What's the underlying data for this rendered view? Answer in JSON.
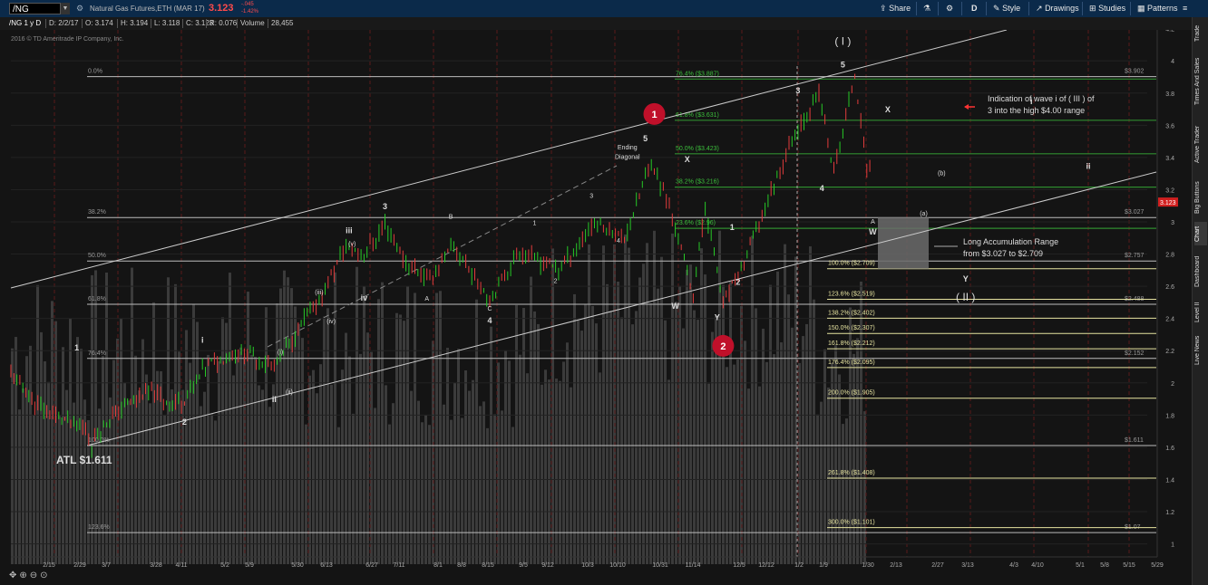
{
  "toolbar": {
    "symbol": "/NG",
    "description": "Natural Gas Futures,ETH (MAR 17)",
    "last": "3.123",
    "change": "-.045",
    "change_pct": "-1.42%",
    "share": "Share",
    "period": "D",
    "style": "Style",
    "drawings": "Drawings",
    "studies": "Studies",
    "patterns": "Patterns"
  },
  "infobar": {
    "name": "/NG 1 y D",
    "date": "D: 2/2/17",
    "open": "O: 3.174",
    "high": "H: 3.194",
    "low": "L: 3.118",
    "close": "C: 3.123",
    "range": "R: 0.076",
    "volume_label": "Volume",
    "volume": "28,455"
  },
  "sidebar": {
    "tabs": [
      "Trade",
      "Times And Sales",
      "Active Trader",
      "Big Buttons",
      "Chart",
      "Dashboard",
      "Level II",
      "Live News"
    ]
  },
  "chart": {
    "copyright": "2016 © TD Ameritrade IP Company, Inc.",
    "price_labels": [
      {
        "v": 4.2,
        "t": "4.2"
      },
      {
        "v": 4.0,
        "t": "4"
      },
      {
        "v": 3.8,
        "t": "3.8"
      },
      {
        "v": 3.6,
        "t": "3.6"
      },
      {
        "v": 3.4,
        "t": "3.4"
      },
      {
        "v": 3.2,
        "t": "3.2"
      },
      {
        "v": 3.0,
        "t": "3"
      },
      {
        "v": 2.8,
        "t": "2.8"
      },
      {
        "v": 2.6,
        "t": "2.6"
      },
      {
        "v": 2.4,
        "t": "2.4"
      },
      {
        "v": 2.2,
        "t": "2.2"
      },
      {
        "v": 2.0,
        "t": "2"
      },
      {
        "v": 1.8,
        "t": "1.8"
      },
      {
        "v": 1.6,
        "t": "1.6"
      },
      {
        "v": 1.4,
        "t": "1.4"
      },
      {
        "v": 1.2,
        "t": "1.2"
      },
      {
        "v": 1.0,
        "t": "1"
      }
    ],
    "last_price_tag": "3.123",
    "date_labels": [
      "2/15",
      "2/29",
      "3/7",
      "3/28",
      "4/11",
      "5/2",
      "5/9",
      "5/30",
      "6/13",
      "6/27",
      "7/11",
      "8/1",
      "8/8",
      "8/15",
      "9/5",
      "9/12",
      "10/3",
      "10/10",
      "10/31",
      "11/14",
      "12/5",
      "12/12",
      "1/2",
      "1/9",
      "1/30",
      "2/13",
      "2/27",
      "3/13",
      "4/3",
      "4/10",
      "5/1",
      "5/8",
      "5/15",
      "5/29"
    ],
    "fib_left": [
      {
        "label": "0.0%",
        "value": 3.902,
        "tag": "$3.902"
      },
      {
        "label": "38.2%",
        "value": 3.027,
        "tag": "$3.027"
      },
      {
        "label": "50.0%",
        "value": 2.757,
        "tag": "$2.757"
      },
      {
        "label": "61.8%",
        "value": 2.488,
        "tag": "$2.488"
      },
      {
        "label": "76.4%",
        "value": 2.152,
        "tag": "$2.152"
      },
      {
        "label": "100.0%",
        "value": 1.611,
        "tag": "$1.611"
      },
      {
        "label": "123.6%",
        "value": 1.07,
        "tag": "$1.07"
      }
    ],
    "fib_green": [
      {
        "label": "76.4% ($3.887)",
        "value": 3.887
      },
      {
        "label": "61.8% ($3.631)",
        "value": 3.631
      },
      {
        "label": "50.0% ($3.423)",
        "value": 3.423
      },
      {
        "label": "38.2% ($3.216)",
        "value": 3.216
      },
      {
        "label": "23.6% ($2.96)",
        "value": 2.96
      }
    ],
    "fib_ext": [
      {
        "label": "100.0% ($2.709)",
        "value": 2.709
      },
      {
        "label": "123.6% ($2.519)",
        "value": 2.519
      },
      {
        "label": "138.2% ($2.402)",
        "value": 2.402
      },
      {
        "label": "150.0% ($2.307)",
        "value": 2.307
      },
      {
        "label": "161.8% ($2.212)",
        "value": 2.212
      },
      {
        "label": "176.4% ($2.095)",
        "value": 2.095
      },
      {
        "label": "200.0% ($1.905)",
        "value": 1.905
      },
      {
        "label": "261.8% ($1.408)",
        "value": 1.408
      },
      {
        "label": "300.0% ($1.101)",
        "value": 1.101
      }
    ],
    "atl": "ATL $1.611",
    "annotation_wave": "Indication of wave i of ( III ) of\n3 into the high $4.00 range",
    "annotation_range": "Long Accumulation Range\nfrom $3.027 to $2.709",
    "wave_labels": [
      {
        "t": "1",
        "d": 22,
        "p": 2.2,
        "w": "b"
      },
      {
        "t": "2",
        "d": 58,
        "p": 1.74,
        "w": "b"
      },
      {
        "t": "i",
        "d": 64,
        "p": 2.25,
        "w": "b"
      },
      {
        "t": "ii",
        "d": 88,
        "p": 1.88,
        "w": "b"
      },
      {
        "t": "(i)",
        "d": 90,
        "p": 2.18,
        "w": "s"
      },
      {
        "t": "(ii)",
        "d": 93,
        "p": 1.93,
        "w": "s"
      },
      {
        "t": "(iii)",
        "d": 103,
        "p": 2.55,
        "w": "s"
      },
      {
        "t": "(iv)",
        "d": 107,
        "p": 2.37,
        "w": "s"
      },
      {
        "t": "(v)",
        "d": 114,
        "p": 2.85,
        "w": "s"
      },
      {
        "t": "iii",
        "d": 113,
        "p": 2.93,
        "w": "b"
      },
      {
        "t": "iv",
        "d": 118,
        "p": 2.51,
        "w": "b"
      },
      {
        "t": "3",
        "d": 125,
        "p": 3.08,
        "w": "b"
      },
      {
        "t": "A",
        "d": 139,
        "p": 2.51,
        "w": "s"
      },
      {
        "t": "B",
        "d": 147,
        "p": 3.02,
        "w": "s"
      },
      {
        "t": "C",
        "d": 160,
        "p": 2.45,
        "w": "s"
      },
      {
        "t": "4",
        "d": 160,
        "p": 2.37,
        "w": "b"
      },
      {
        "t": "1",
        "d": 175,
        "p": 2.98,
        "w": "s"
      },
      {
        "t": "2",
        "d": 182,
        "p": 2.62,
        "w": "s"
      },
      {
        "t": "3",
        "d": 194,
        "p": 3.15,
        "w": "s"
      },
      {
        "t": "4",
        "d": 203,
        "p": 2.87,
        "w": "s"
      },
      {
        "t": "Ending",
        "d": 206,
        "p": 3.45,
        "w": "s"
      },
      {
        "t": "Diagonal",
        "d": 206,
        "p": 3.39,
        "w": "s"
      },
      {
        "t": "5",
        "d": 212,
        "p": 3.5,
        "w": "b"
      },
      {
        "t": "W",
        "d": 222,
        "p": 2.46,
        "w": "b"
      },
      {
        "t": "X",
        "d": 226,
        "p": 3.37,
        "w": "b"
      },
      {
        "t": "Y",
        "d": 236,
        "p": 2.39,
        "w": "b"
      },
      {
        "t": "1",
        "d": 241,
        "p": 2.95,
        "w": "b"
      },
      {
        "t": "2",
        "d": 243,
        "p": 2.61,
        "w": "b"
      },
      {
        "t": "3",
        "d": 263,
        "p": 3.8,
        "w": "b"
      },
      {
        "t": "4",
        "d": 271,
        "p": 3.19,
        "w": "b"
      },
      {
        "t": "5",
        "d": 278,
        "p": 3.96,
        "w": "b"
      },
      {
        "t": "( I )",
        "d": 278,
        "p": 4.1,
        "w": "l"
      },
      {
        "t": "A",
        "d": 288,
        "p": 2.99,
        "w": "s"
      },
      {
        "t": "W",
        "d": 288,
        "p": 2.92,
        "w": "b"
      },
      {
        "t": "X",
        "d": 293,
        "p": 3.68,
        "w": "b"
      },
      {
        "t": "(a)",
        "d": 305,
        "p": 3.04,
        "w": "s"
      },
      {
        "t": "(b)",
        "d": 311,
        "p": 3.29,
        "w": "s"
      },
      {
        "t": "Y",
        "d": 319,
        "p": 2.63,
        "w": "b"
      },
      {
        "t": "( II )",
        "d": 319,
        "p": 2.51,
        "w": "l"
      },
      {
        "t": "i",
        "d": 341,
        "p": 3.73,
        "w": "b"
      },
      {
        "t": "ii",
        "d": 360,
        "p": 3.33,
        "w": "b"
      }
    ],
    "circle_labels": [
      {
        "t": "1",
        "d": 215,
        "p": 3.67
      },
      {
        "t": "2",
        "d": 238,
        "p": 2.23
      }
    ]
  }
}
